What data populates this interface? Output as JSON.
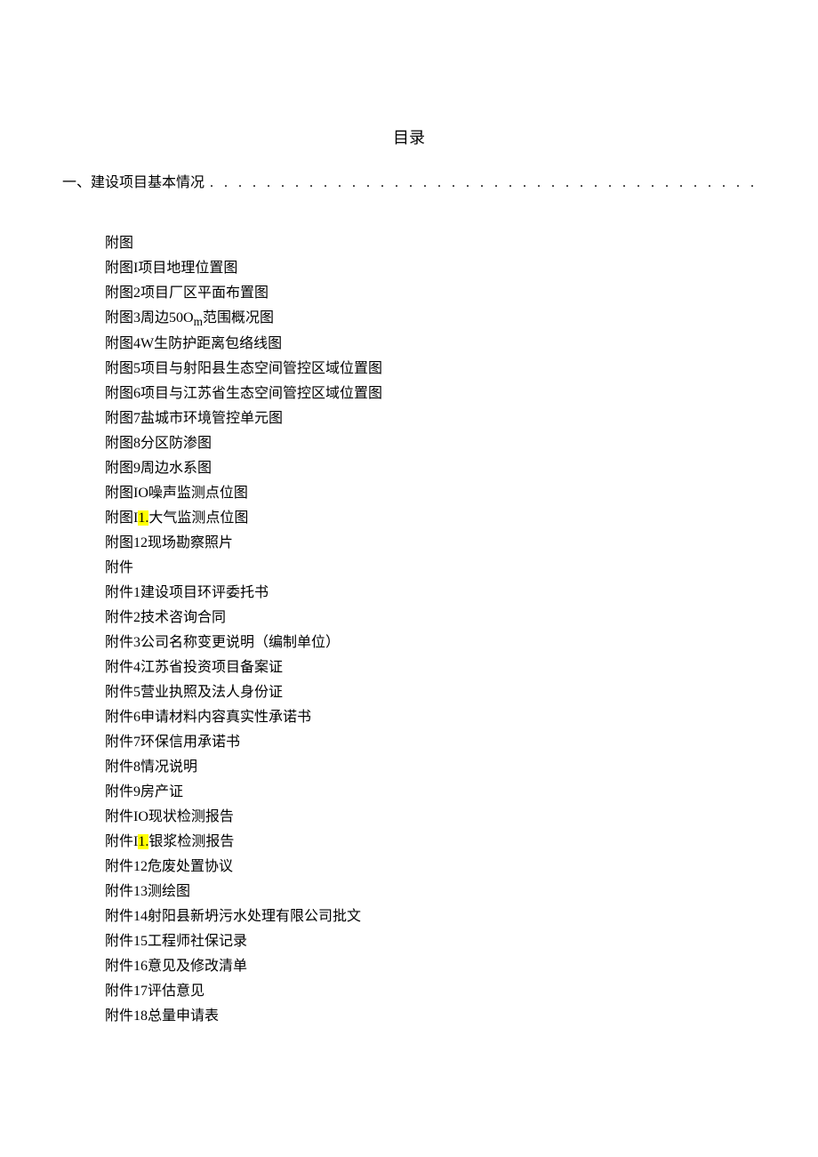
{
  "title": "目录",
  "toc_main": {
    "label": "一、建设项目基本情况",
    "dots": ". . . . . . . . . . . . . . . . . . . . . . . . . . . . . . . . . . . . . . . . . . . . . . . . . . . . . . . . . . . . . . . . . . . . . . . ."
  },
  "figures": {
    "header": "附图",
    "items": [
      {
        "prefix": "附图I",
        "text": "项目地理位置图"
      },
      {
        "prefix": "附图2",
        "text": "项目厂区平面布置图"
      },
      {
        "prefix": "附图3周边50O",
        "sub": "m",
        "text": "范围概况图"
      },
      {
        "prefix": "附图4W",
        "text": "生防护距离包络线图"
      },
      {
        "prefix": "附图5",
        "text": "项目与射阳县生态空间管控区域位置图"
      },
      {
        "prefix": "附图6",
        "text": "项目与江苏省生态空间管控区域位置图"
      },
      {
        "prefix": "附图7",
        "text": "盐城市环境管控单元图"
      },
      {
        "prefix": "附图8",
        "text": "分区防渗图"
      },
      {
        "prefix": "附图9",
        "text": "周边水系图"
      },
      {
        "prefix": "附图IO",
        "text": "噪声监测点位图"
      },
      {
        "prefix": "附图I",
        "hl": "1.",
        "text": "大气监测点位图"
      },
      {
        "prefix": "附图12",
        "text": "现场勘察照片"
      }
    ]
  },
  "attachments": {
    "header": "附件",
    "items": [
      {
        "prefix": "附件1",
        "text": "建设项目环评委托书"
      },
      {
        "prefix": "附件2",
        "text": "技术咨询合同"
      },
      {
        "prefix": "附件3",
        "text": "公司名称变更说明（编制单位）"
      },
      {
        "prefix": "附件4",
        "text": "江苏省投资项目备案证"
      },
      {
        "prefix": "附件5",
        "text": "营业执照及法人身份证"
      },
      {
        "prefix": "附件6",
        "text": "申请材料内容真实性承诺书"
      },
      {
        "prefix": "附件7",
        "text": "环保信用承诺书"
      },
      {
        "prefix": "附件8",
        "text": "情况说明"
      },
      {
        "prefix": "附件9",
        "text": "房产证"
      },
      {
        "prefix": "附件IO",
        "text": "现状检测报告"
      },
      {
        "prefix": "附件I",
        "hl": "1.",
        "text": "银浆检测报告"
      },
      {
        "prefix": "附件12",
        "text": "危废处置协议"
      },
      {
        "prefix": "附件13",
        "text": "测绘图"
      },
      {
        "prefix": "附件14",
        "text": "射阳县新坍污水处理有限公司批文"
      },
      {
        "prefix": "附件15",
        "text": "工程师社保记录"
      },
      {
        "prefix": "附件16",
        "text": "意见及修改清单"
      },
      {
        "prefix": "附件17",
        "text": "评估意见"
      },
      {
        "prefix": "附件18",
        "text": "总量申请表"
      }
    ]
  }
}
